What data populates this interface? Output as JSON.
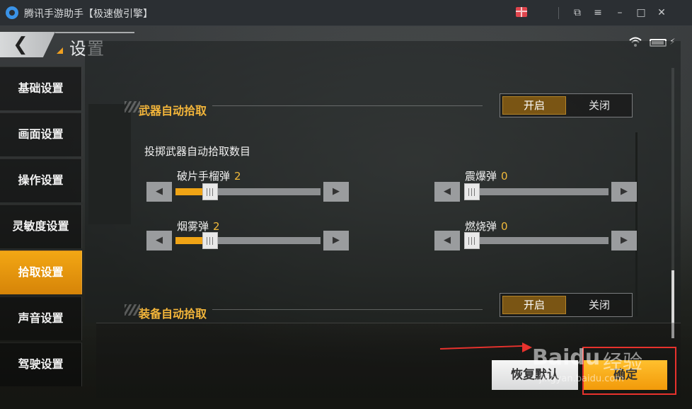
{
  "window": {
    "title": "腾讯手游助手【极速傲引擎】",
    "controls": [
      "gift-icon",
      "popout-icon",
      "menu-icon",
      "minimize-icon",
      "maximize-icon",
      "close-icon"
    ]
  },
  "header": {
    "title": "设置",
    "back_icon": "back-arrow-icon"
  },
  "sidebar": {
    "items": [
      {
        "label": "基础设置",
        "active": false
      },
      {
        "label": "画面设置",
        "active": false
      },
      {
        "label": "操作设置",
        "active": false
      },
      {
        "label": "灵敏度设置",
        "active": false
      },
      {
        "label": "拾取设置",
        "active": true
      },
      {
        "label": "声音设置",
        "active": false
      },
      {
        "label": "驾驶设置",
        "active": false
      }
    ]
  },
  "main": {
    "weapon_pickup": {
      "title": "武器自动拾取",
      "toggle": {
        "on_label": "开启",
        "off_label": "关闭",
        "selected": "开启"
      }
    },
    "throwables_heading": "投掷武器自动拾取数目",
    "sliders": [
      {
        "label": "破片手榴弹",
        "value": "2",
        "fraction": 0.24
      },
      {
        "label": "震爆弹",
        "value": "0",
        "fraction": 0.0
      },
      {
        "label": "烟雾弹",
        "value": "2",
        "fraction": 0.24
      },
      {
        "label": "燃烧弹",
        "value": "0",
        "fraction": 0.0
      }
    ],
    "equipment_pickup": {
      "title": "装备自动拾取",
      "toggle": {
        "on_label": "开启",
        "off_label": "关闭",
        "selected": "开启"
      }
    }
  },
  "footer": {
    "reset_label": "恢复默认",
    "confirm_label": "确定"
  },
  "watermark": {
    "brand": "Baidu",
    "cn": "经验",
    "url": "jingyan.baidu.com"
  },
  "colors": {
    "accent": "#f0a415",
    "active_tab": "#e5950f",
    "section_title": "#f3b53a",
    "annotation": "#e8322d"
  }
}
